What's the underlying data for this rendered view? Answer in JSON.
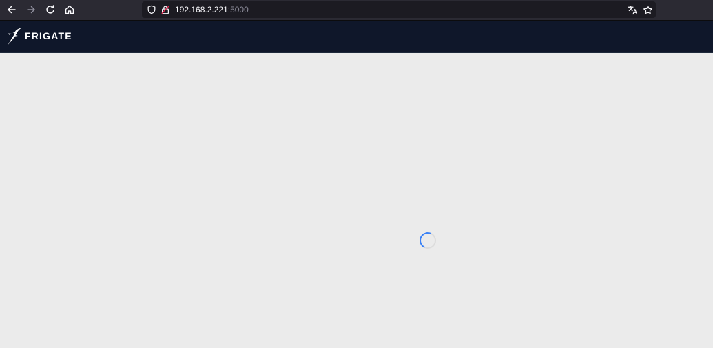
{
  "browser": {
    "url_host": "192.168.2.221",
    "url_port": ":5000"
  },
  "app": {
    "brand": "FRIGATE"
  },
  "icons": {
    "back": "arrow-left-icon",
    "forward": "arrow-right-icon",
    "reload": "reload-icon",
    "home": "home-icon",
    "tracking_protection": "shield-icon",
    "insecure": "lock-warning-icon",
    "translate": "translate-icon",
    "bookmark": "star-icon",
    "logo": "frigate-bird-icon"
  },
  "colors": {
    "header_bg": "#0f172a",
    "page_bg": "#ebebeb",
    "spinner_accent": "#3b82f6"
  }
}
